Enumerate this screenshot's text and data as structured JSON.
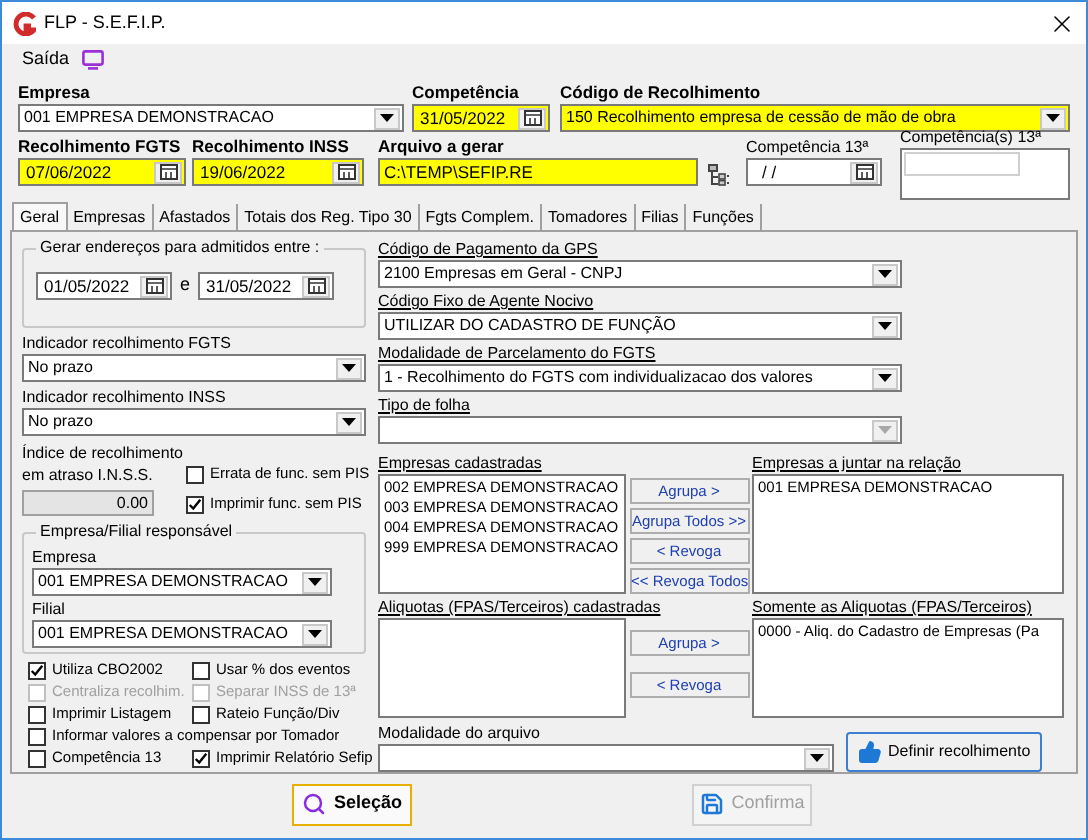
{
  "window": {
    "title": "FLP - S.E.F.I.P."
  },
  "menu": [
    {
      "label": "Saída"
    }
  ],
  "header": {
    "empresa": {
      "label": "Empresa",
      "value": "001 EMPRESA DEMONSTRACAO",
      "highlighted": false
    },
    "competencia": {
      "label": "Competência",
      "value": "31/05/2022",
      "highlighted": true
    },
    "codigo": {
      "label": "Código de Recolhimento",
      "value": "150 Recolhimento empresa de cessão de mão de obra",
      "highlighted": true
    },
    "fgts": {
      "label": "Recolhimento FGTS",
      "value": "07/06/2022",
      "highlighted": true
    },
    "inss": {
      "label": "Recolhimento INSS",
      "value": "19/06/2022",
      "highlighted": true
    },
    "arquivo": {
      "label": "Arquivo a gerar",
      "value": "C:\\TEMP\\SEFIP.RE",
      "highlighted": true
    },
    "comp13": {
      "label": "Competência 13ª",
      "value": "/ /",
      "highlighted": false
    },
    "comps13": {
      "label": "Competência(s) 13ª"
    }
  },
  "tabs": [
    {
      "label": "Geral",
      "selected": true
    },
    {
      "label": "Empresas",
      "selected": false
    },
    {
      "label": "Afastados",
      "selected": false
    },
    {
      "label": "Totais dos Reg. Tipo 30",
      "selected": false
    },
    {
      "label": "Fgts Complem.",
      "selected": false
    },
    {
      "label": "Tomadores",
      "selected": false
    },
    {
      "label": "Filias",
      "selected": false
    },
    {
      "label": "Funções",
      "selected": false
    }
  ],
  "date_range": {
    "legend": "Gerar endereços para admitidos entre :",
    "from": "01/05/2022",
    "separator": "e",
    "to": "31/05/2022"
  },
  "indicador_fgts": {
    "label": "Indicador recolhimento FGTS",
    "value": "No prazo"
  },
  "indicador_inss": {
    "label": "Indicador recolhimento INSS",
    "value": "No prazo"
  },
  "indice": {
    "label_lines": [
      "Índice de recolhimento",
      "em atraso I.N.S.S."
    ],
    "value": "0.00"
  },
  "pis_checks": [
    {
      "label": "Errata de func. sem PIS",
      "checked": false
    },
    {
      "label": "Imprimir func. sem PIS",
      "checked": true
    }
  ],
  "responsavel": {
    "legend": "Empresa/Filial responsável",
    "empresa_label": "Empresa",
    "empresa": "001 EMPRESA DEMONSTRACAO",
    "filial_label": "Filial",
    "filial": "001 EMPRESA DEMONSTRACAO"
  },
  "option_rows": [
    [
      {
        "label": "Utiliza CBO2002",
        "checked": true,
        "disabled": false
      },
      {
        "label": "Usar % dos eventos",
        "checked": false,
        "disabled": false
      }
    ],
    [
      {
        "label": "Centraliza recolhim.",
        "checked": false,
        "disabled": true
      },
      {
        "label": "Separar INSS de 13ª",
        "checked": false,
        "disabled": true
      }
    ],
    [
      {
        "label": "Imprimir Listagem",
        "checked": false,
        "disabled": false
      },
      {
        "label": "Rateio Função/Div",
        "checked": false,
        "disabled": false
      }
    ],
    [
      {
        "label": "Informar valores a compensar por Tomador",
        "checked": false,
        "disabled": false
      }
    ],
    [
      {
        "label": "Competência 13",
        "checked": false,
        "disabled": false
      },
      {
        "label": "Imprimir Relatório Sefip",
        "checked": true,
        "disabled": false
      }
    ]
  ],
  "gps": {
    "label": "Código de Pagamento da GPS",
    "value": "2100  Empresas em Geral - CNPJ",
    "disabled": false
  },
  "agente": {
    "label": "Código Fixo de Agente Nocivo",
    "value": "UTILIZAR DO CADASTRO DE FUNÇÃO",
    "disabled": false
  },
  "parcelamento": {
    "label": "Modalidade de Parcelamento do FGTS",
    "value": "1 - Recolhimento do FGTS com individualizacao dos valores",
    "disabled": false
  },
  "tipo_folha": {
    "label": "Tipo de folha",
    "disabled": true
  },
  "empresas": {
    "left_label": "Empresas cadastradas",
    "left_items": [
      "002 EMPRESA DEMONSTRACAO",
      "003 EMPRESA DEMONSTRACAO",
      "004 EMPRESA DEMONSTRACAO",
      "999 EMPRESA DEMONSTRACAO"
    ],
    "buttons": [
      "Agrupa >",
      "Agrupa Todos >>",
      "< Revoga",
      "<< Revoga Todos"
    ],
    "right_label": "Empresas a juntar na relação",
    "right_items": [
      "001 EMPRESA DEMONSTRACAO"
    ]
  },
  "aliquotas": {
    "left_label": "Aliquotas (FPAS/Terceiros) cadastradas",
    "buttons": [
      "Agrupa >",
      "< Revoga"
    ],
    "right_label": "Somente as Aliquotas (FPAS/Terceiros)",
    "right_items": [
      "0000 - Aliq. do Cadastro de Empresas (Pa"
    ]
  },
  "modalidade": {
    "label": "Modalidade do arquivo",
    "disabled": false
  },
  "definir": {
    "label": "Definir recolhimento"
  },
  "buttons": [
    {
      "kind": "search",
      "label": "Seleção",
      "disabled": false
    },
    {
      "kind": "save",
      "label": "Confirma",
      "disabled": true
    }
  ]
}
